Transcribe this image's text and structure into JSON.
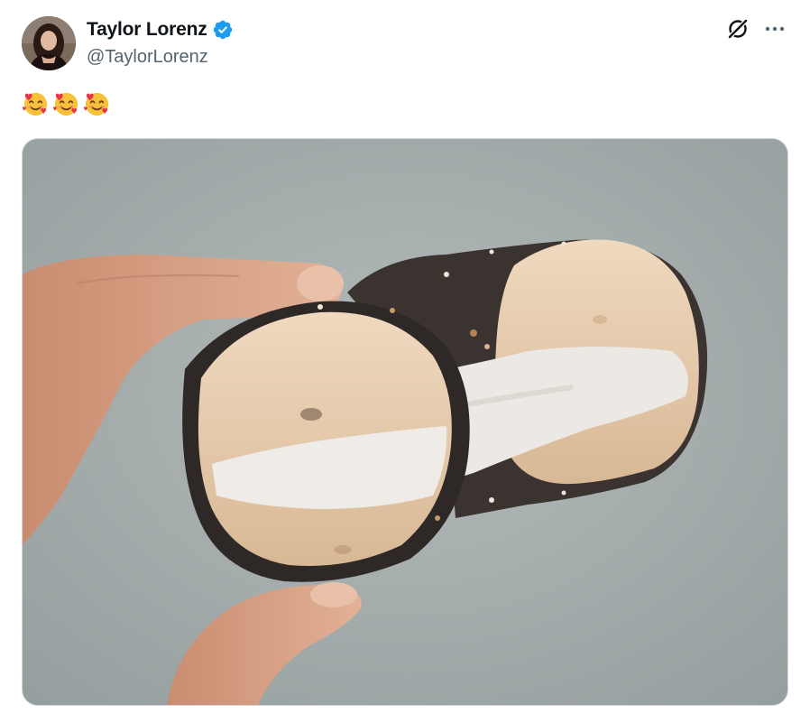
{
  "author": {
    "display_name": "Taylor Lorenz",
    "handle": "@TaylorLorenz",
    "verified": true,
    "avatar_icon": "profile-photo",
    "verified_icon": "verified-badge-icon",
    "verified_color": "#1d9bf0"
  },
  "header_actions": {
    "grok_icon": "grok-icon",
    "more_icon": "more-options-icon"
  },
  "tweet": {
    "text_emojis": [
      "🥰",
      "🥰",
      "🥰"
    ],
    "emoji_icon": "smiling-face-with-hearts-emoji"
  },
  "media": {
    "type": "photo",
    "subject": "bagel-photo",
    "alt": ""
  },
  "colors": {
    "name_text": "#0f1419",
    "handle_text": "#536471",
    "border": "#cfd9de"
  }
}
